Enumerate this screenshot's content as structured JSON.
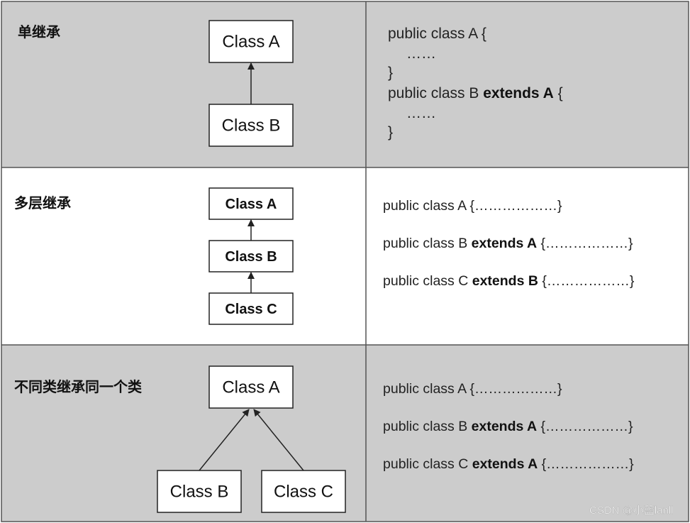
{
  "colors": {
    "shaded_row": "#cccccc",
    "plain_row": "#ffffff",
    "border": "#555555"
  },
  "rows": [
    {
      "label": "单继承",
      "classes": [
        "Class A",
        "Class B"
      ],
      "code": [
        {
          "normal": "public class A {",
          "bold": "",
          "tail": ""
        },
        {
          "normal": "……",
          "bold": "",
          "tail": ""
        },
        {
          "normal": "}",
          "bold": "",
          "tail": ""
        },
        {
          "normal": "public class B ",
          "bold": "extends A",
          "tail": " {"
        },
        {
          "normal": "……",
          "bold": "",
          "tail": ""
        },
        {
          "normal": "}",
          "bold": "",
          "tail": ""
        }
      ]
    },
    {
      "label": "多层继承",
      "classes": [
        "Class A",
        "Class B",
        "Class C"
      ],
      "code": [
        {
          "normal": "public class A {………………}",
          "bold": "",
          "tail": ""
        },
        {
          "normal": "public class B ",
          "bold": "extends A",
          "tail": " {………………}"
        },
        {
          "normal": "public class C ",
          "bold": "extends B",
          "tail": " {………………}"
        }
      ]
    },
    {
      "label": "不同类继承同一个类",
      "classes": [
        "Class A",
        "Class B",
        "Class C"
      ],
      "code": [
        {
          "normal": "public class A {………………}",
          "bold": "",
          "tail": ""
        },
        {
          "normal": "public class B ",
          "bold": "extends A",
          "tail": " {………………}"
        },
        {
          "normal": "public class C ",
          "bold": "extends A",
          "tail": " {………………}"
        }
      ]
    }
  ],
  "watermark": "CSDN @小蓝lanll"
}
